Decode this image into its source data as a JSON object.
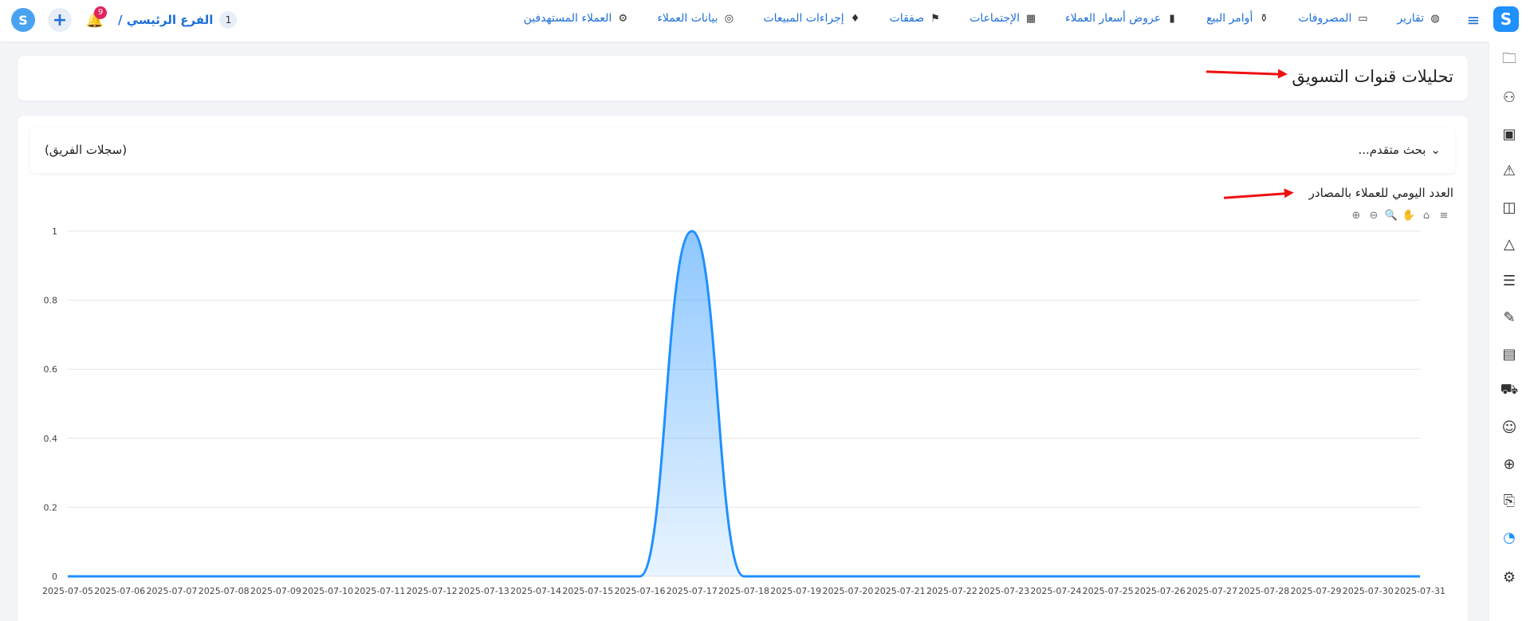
{
  "topbar": {
    "logo": "S",
    "nav": [
      {
        "label": "العملاء المستهدفين",
        "icon": "users-target-icon"
      },
      {
        "label": "بيانات العملاء",
        "icon": "customer-data-icon"
      },
      {
        "label": "إجراءات المبيعات",
        "icon": "sales-actions-icon"
      },
      {
        "label": "صفقات",
        "icon": "deals-icon"
      },
      {
        "label": "الإجتماعات",
        "icon": "meetings-icon"
      },
      {
        "label": "عروض أسعار العملاء",
        "icon": "quotes-icon"
      },
      {
        "label": "أوامر البيع",
        "icon": "sales-orders-icon"
      },
      {
        "label": "المصروفات",
        "icon": "expenses-icon"
      },
      {
        "label": "تقارير",
        "icon": "reports-icon"
      }
    ],
    "branch": {
      "name": "الفرع الرئيسي /",
      "number": "1"
    },
    "notifications": "9"
  },
  "page": {
    "title": "تحليلات قنوات التسويق",
    "advanced_search": "بحث متقدم...",
    "team_records": "(سجلات الفريق)",
    "chart_title": "العدد اليومي للعملاء بالمصادر"
  },
  "colors": {
    "accent": "#1e90ff",
    "arrow": "#e11111"
  },
  "chart_data": {
    "type": "area",
    "x": [
      "2025-07-05",
      "2025-07-06",
      "2025-07-07",
      "2025-07-08",
      "2025-07-09",
      "2025-07-10",
      "2025-07-11",
      "2025-07-12",
      "2025-07-13",
      "2025-07-14",
      "2025-07-15",
      "2025-07-16",
      "2025-07-17",
      "2025-07-18",
      "2025-07-19",
      "2025-07-20",
      "2025-07-21",
      "2025-07-22",
      "2025-07-23",
      "2025-07-24",
      "2025-07-25",
      "2025-07-26",
      "2025-07-27",
      "2025-07-28",
      "2025-07-29",
      "2025-07-30",
      "2025-07-31"
    ],
    "values": [
      0,
      0,
      0,
      0,
      0,
      0,
      0,
      0,
      0,
      0,
      0,
      0,
      1,
      0,
      0,
      0,
      0,
      0,
      0,
      0,
      0,
      0,
      0,
      0,
      0,
      0,
      0
    ],
    "y_ticks": [
      "0",
      "0.2",
      "0.4",
      "0.6",
      "0.8",
      "1"
    ],
    "ylim": [
      0,
      1
    ],
    "grid": true
  }
}
